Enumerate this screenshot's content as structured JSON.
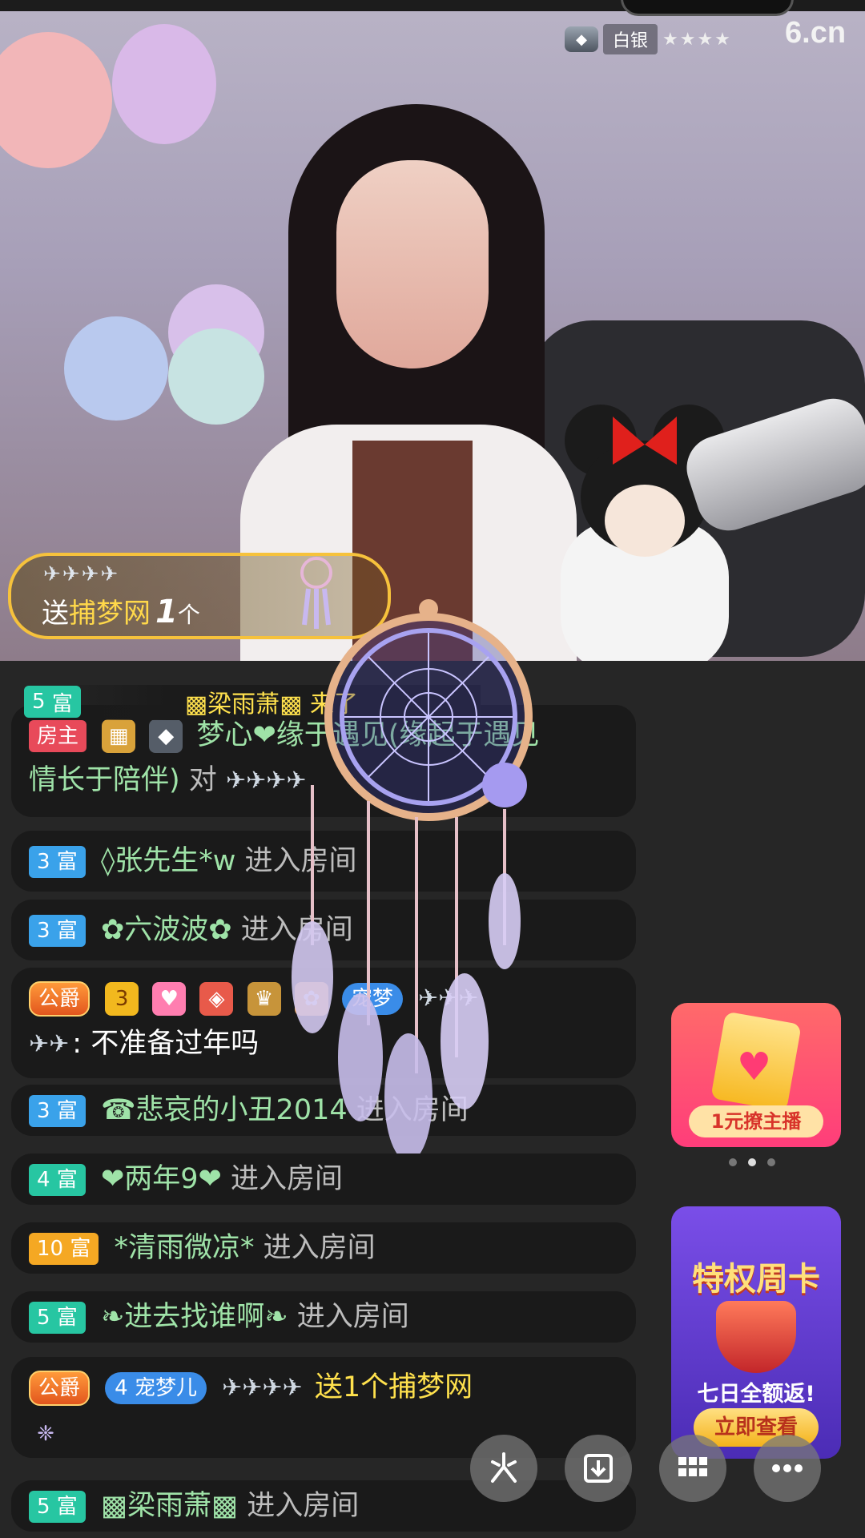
{
  "stream": {
    "rank_label": "白银",
    "rank_stars": "★★★★",
    "site_logo": "6.cn"
  },
  "gift_banner": {
    "planes": "✈✈✈✈",
    "verb": "送",
    "gift_name": "捕梦网",
    "count": "1",
    "unit": "个"
  },
  "enter_notice": {
    "level_num": "5",
    "level_label": "富",
    "text": "▩梁雨萧▩ 来了"
  },
  "chat": [
    {
      "badge": "房主",
      "name": "梦心❤缘于遇见(缘起于遇见",
      "name2": "情长于陪伴)",
      "text": "对"
    },
    {
      "level": "3 富",
      "name": "◊张先生*w",
      "text": "进入房间"
    },
    {
      "level": "3 富",
      "name": "✿六波波✿",
      "text": "进入房间"
    },
    {
      "badge": "公爵",
      "star_level": "3",
      "pet": "宠梦",
      "message": ": 不准备过年吗"
    },
    {
      "level": "3 富",
      "name": "☎悲哀的小丑2014",
      "text": "进入房间"
    },
    {
      "level": "4 富",
      "name": "❤两年9❤",
      "text": "进入房间"
    },
    {
      "level": "10 富",
      "name": "*清雨微凉*",
      "text": "进入房间"
    },
    {
      "level": "5 富",
      "name": "❧进去找谁啊❧",
      "text": "进入房间"
    },
    {
      "badge": "公爵",
      "pet": "宠梦儿",
      "pet_level": "4",
      "gift_text": "送1个捕梦网"
    },
    {
      "level": "5 富",
      "name": "▩梁雨萧▩",
      "text": "进入房间"
    }
  ],
  "promo": {
    "label": "1元撩主播",
    "carousel_total": 3,
    "carousel_active": 2
  },
  "week_card": {
    "title": "特权周卡",
    "subtitle": "七日全额返!",
    "button": "立即查看"
  },
  "fabs": [
    {
      "icon": "share-icon"
    },
    {
      "icon": "download-icon"
    },
    {
      "icon": "grid-menu-icon"
    },
    {
      "icon": "more-icon"
    }
  ]
}
